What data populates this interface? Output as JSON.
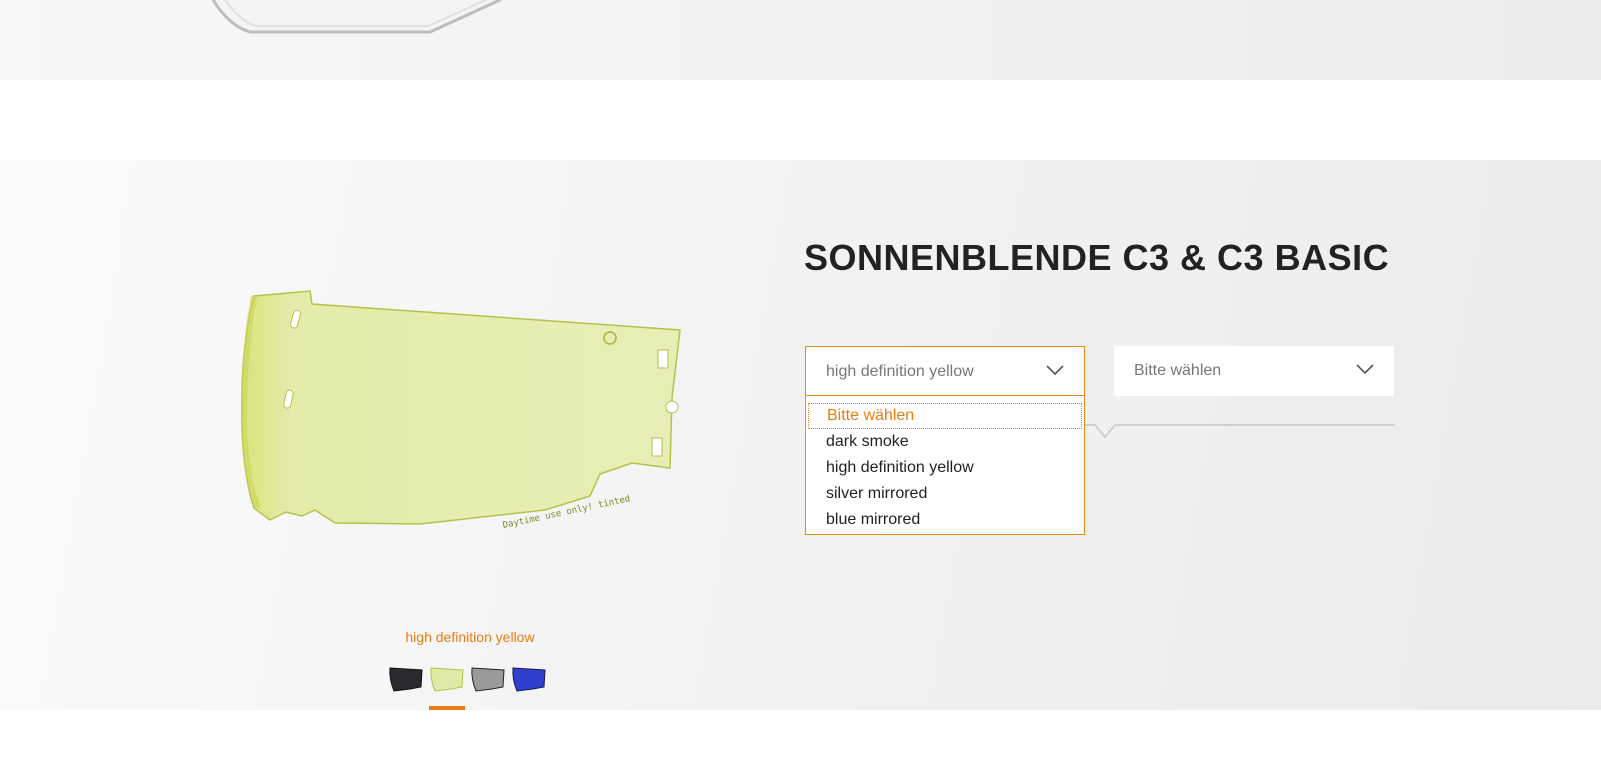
{
  "product": {
    "title": "SONNENBLENDE C3 & C3 BASIC",
    "visor_print": "Daytime use only! tinted"
  },
  "selects": {
    "color": {
      "selected": "high definition yellow",
      "options": [
        {
          "label": "Bitte wählen"
        },
        {
          "label": "dark smoke"
        },
        {
          "label": "high definition yellow"
        },
        {
          "label": "silver mirrored"
        },
        {
          "label": "blue mirrored"
        }
      ]
    },
    "size": {
      "selected": "Bitte wählen"
    }
  },
  "gallery": {
    "caption": "high definition yellow",
    "thumbnails": [
      {
        "name": "dark smoke",
        "color": "#2a2a2e"
      },
      {
        "name": "high definition yellow",
        "color": "#dfeaa6"
      },
      {
        "name": "silver mirrored",
        "color": "#9a9a9a"
      },
      {
        "name": "blue mirrored",
        "color": "#2f3fd0"
      }
    ],
    "active_index": 1
  },
  "colors": {
    "accent": "#e87d10",
    "visor_yellow": "#e2ebab"
  }
}
